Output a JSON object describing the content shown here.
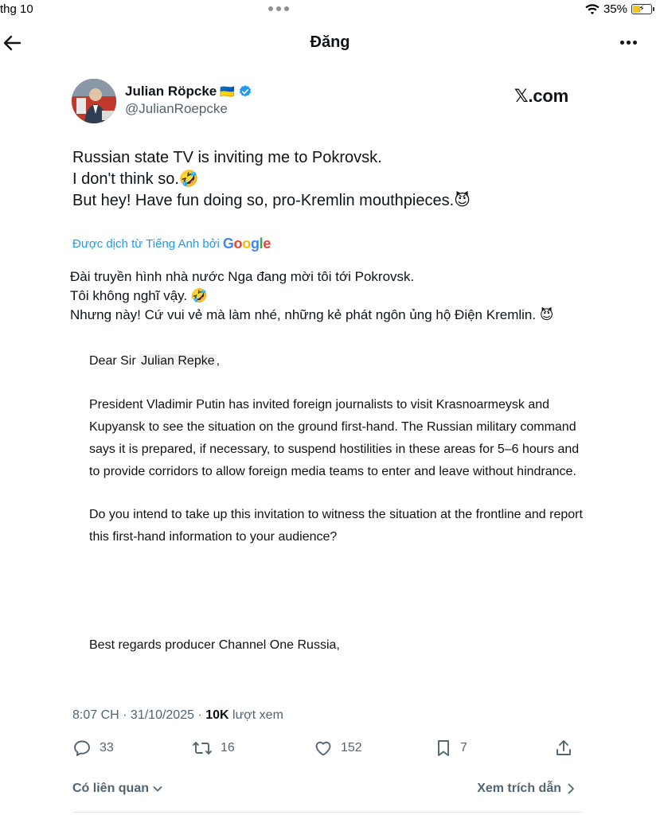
{
  "status_bar": {
    "time": "thg 10",
    "battery": "35%"
  },
  "nav": {
    "title": "Đăng"
  },
  "author": {
    "name": "Julian Röpcke",
    "flag": "🇺🇦",
    "handle": "@JulianRoepcke"
  },
  "source_watermark": "𝕏.com",
  "tweet": {
    "lines": [
      "Russian state TV is inviting me to Pokrovsk.",
      "I don't think so.🤣",
      "But hey! Have fun doing so, pro-Kremlin mouthpieces.😈"
    ]
  },
  "translation": {
    "note": "Được dịch từ Tiếng Anh bởi",
    "provider": "Google",
    "lines": [
      "Đài truyền hình nhà nước Nga đang mời tôi tới Pokrovsk.",
      "Tôi không nghĩ vậy. 🤣",
      "Nhưng này! Cứ vui vẻ mà làm nhé, những kẻ phát ngôn ủng hộ Điện Kremlin. 😈"
    ]
  },
  "letter": {
    "greeting_prefix": "Dear Sir ",
    "greeting_name": "Julian Repke",
    "greeting_suffix": ",",
    "para1": "President Vladimir Putin has invited foreign journalists to visit Krasnoarmeysk and Kupyansk to see the situation on the ground first-hand. The Russian military command says it is prepared, if necessary, to suspend hostilities in these areas for 5–6 hours and to provide corridors to allow foreign media teams to enter and leave without hindrance.",
    "para2": "Do you intend to take up this invitation to witness the situation at the frontline and report this first-hand information to your audience?",
    "signoff": "Best regards producer Channel One Russia,"
  },
  "meta": {
    "time": "8:07 CH",
    "sep": " · ",
    "date": "31/10/2025",
    "views_count": "10K",
    "views_label": " lượt xem"
  },
  "actions": {
    "replies": "33",
    "reposts": "16",
    "likes": "152",
    "bookmarks": "7"
  },
  "footer": {
    "related": "Có liên quan",
    "quotes": "Xem trích dẫn"
  },
  "icons": [
    "back-arrow-icon",
    "more-icon",
    "verified-badge-icon",
    "reply-icon",
    "repost-icon",
    "like-icon",
    "bookmark-icon",
    "share-icon",
    "chevron-down-icon",
    "chevron-right-icon",
    "wifi-icon",
    "battery-icon"
  ],
  "colors": {
    "link": "#1d9bf0",
    "muted": "#536471",
    "verified": "#1d9bf0",
    "battery_fill": "#f5c518"
  }
}
